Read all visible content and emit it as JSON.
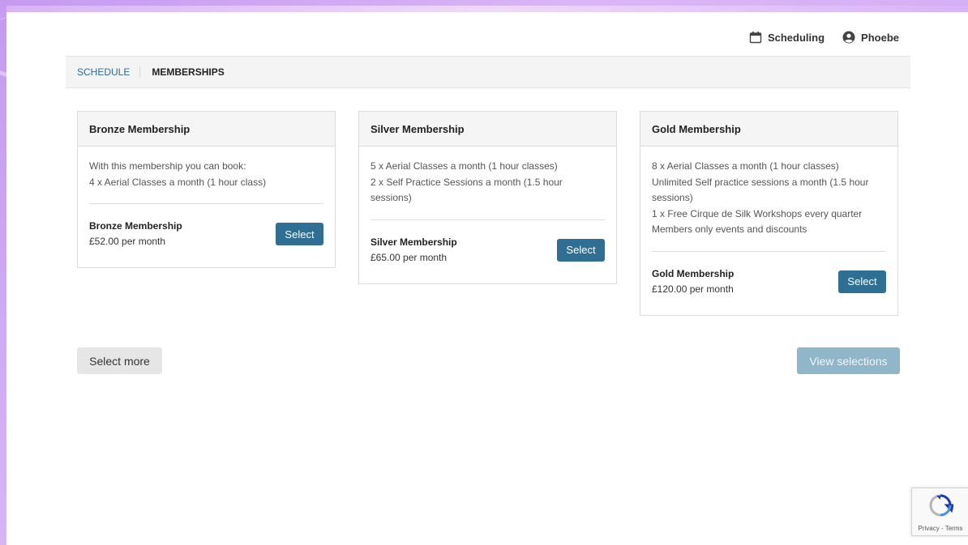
{
  "header": {
    "scheduling_label": "Scheduling",
    "user_name": "Phoebe"
  },
  "nav": {
    "schedule_label": "SCHEDULE",
    "memberships_label": "MEMBERSHIPS"
  },
  "memberships": [
    {
      "title": "Bronze Membership",
      "description": [
        "With this membership you can book:",
        "4 x Aerial Classes a month (1 hour class)"
      ],
      "price_name": "Bronze Membership",
      "price": "£52.00 per month",
      "button_label": "Select"
    },
    {
      "title": "Silver Membership",
      "description": [
        "5 x Aerial Classes a month (1 hour classes)",
        "2 x Self Practice Sessions a month (1.5 hour sessions)"
      ],
      "price_name": "Silver Membership",
      "price": "£65.00 per month",
      "button_label": "Select"
    },
    {
      "title": "Gold Membership",
      "description": [
        "8 x Aerial Classes a month (1 hour classes)",
        "Unlimited Self practice sessions a month (1.5 hour sessions)",
        "1 x Free Cirque de Silk Workshops every quarter",
        "Members only events and discounts"
      ],
      "price_name": "Gold Membership",
      "price": "£120.00 per month",
      "button_label": "Select"
    }
  ],
  "actions": {
    "select_more_label": "Select more",
    "view_selections_label": "View selections"
  },
  "recaptcha": {
    "text": "Privacy - Terms"
  },
  "colors": {
    "primary_button": "#2e6f93",
    "disabled_button": "#8fb6c9",
    "link": "#2a6d96",
    "background_frame": "#c59af0"
  },
  "icons": {
    "scheduling": "calendar-icon",
    "user": "user-circle-icon",
    "recaptcha": "recaptcha-icon"
  }
}
